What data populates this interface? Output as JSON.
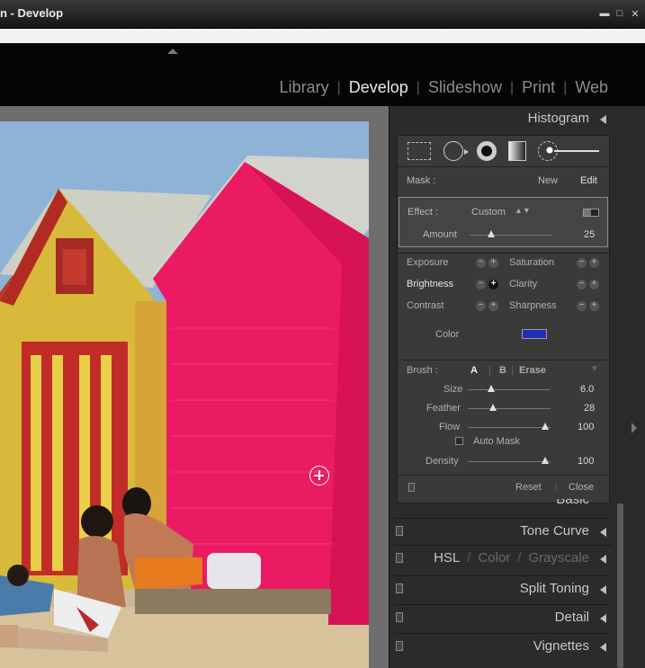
{
  "window": {
    "title": "n - Develop"
  },
  "modules": [
    {
      "label": "Library",
      "active": false
    },
    {
      "label": "Develop",
      "active": true
    },
    {
      "label": "Slideshow",
      "active": false
    },
    {
      "label": "Print",
      "active": false
    },
    {
      "label": "Web",
      "active": false
    }
  ],
  "panels": {
    "histogram": "Histogram",
    "basic": "Basic",
    "tone_curve": "Tone Curve",
    "hsl": {
      "hsl": "HSL",
      "color": "Color",
      "grayscale": "Grayscale"
    },
    "split_toning": "Split Toning",
    "detail": "Detail",
    "vignettes": "Vignettes"
  },
  "tool_icons": [
    "crop-overlay-icon",
    "spot-removal-icon",
    "red-eye-icon",
    "graduated-filter-icon",
    "adjustment-brush-icon"
  ],
  "mask": {
    "label": "Mask :",
    "new": "New",
    "edit": "Edit"
  },
  "effect": {
    "label": "Effect :",
    "value": "Custom",
    "amount_label": "Amount",
    "amount_value": "25",
    "amount_fraction": 0.26
  },
  "adjustments": {
    "exposure": "Exposure",
    "saturation": "Saturation",
    "brightness": "Brightness",
    "clarity": "Clarity",
    "contrast": "Contrast",
    "sharpness": "Sharpness",
    "color": "Color",
    "color_swatch": "#1f2fb8"
  },
  "brush": {
    "label": "Brush :",
    "tab_a": "A",
    "tab_b": "B",
    "tab_erase": "Erase",
    "size_label": "Size",
    "size_value": "6.0",
    "size_fraction": 0.28,
    "feather_label": "Feather",
    "feather_value": "28",
    "feather_fraction": 0.3,
    "flow_label": "Flow",
    "flow_value": "100",
    "flow_fraction": 0.94,
    "auto_mask": "Auto Mask",
    "density_label": "Density",
    "density_value": "100",
    "density_fraction": 0.94
  },
  "footer": {
    "reset": "Reset",
    "close": "Close"
  }
}
